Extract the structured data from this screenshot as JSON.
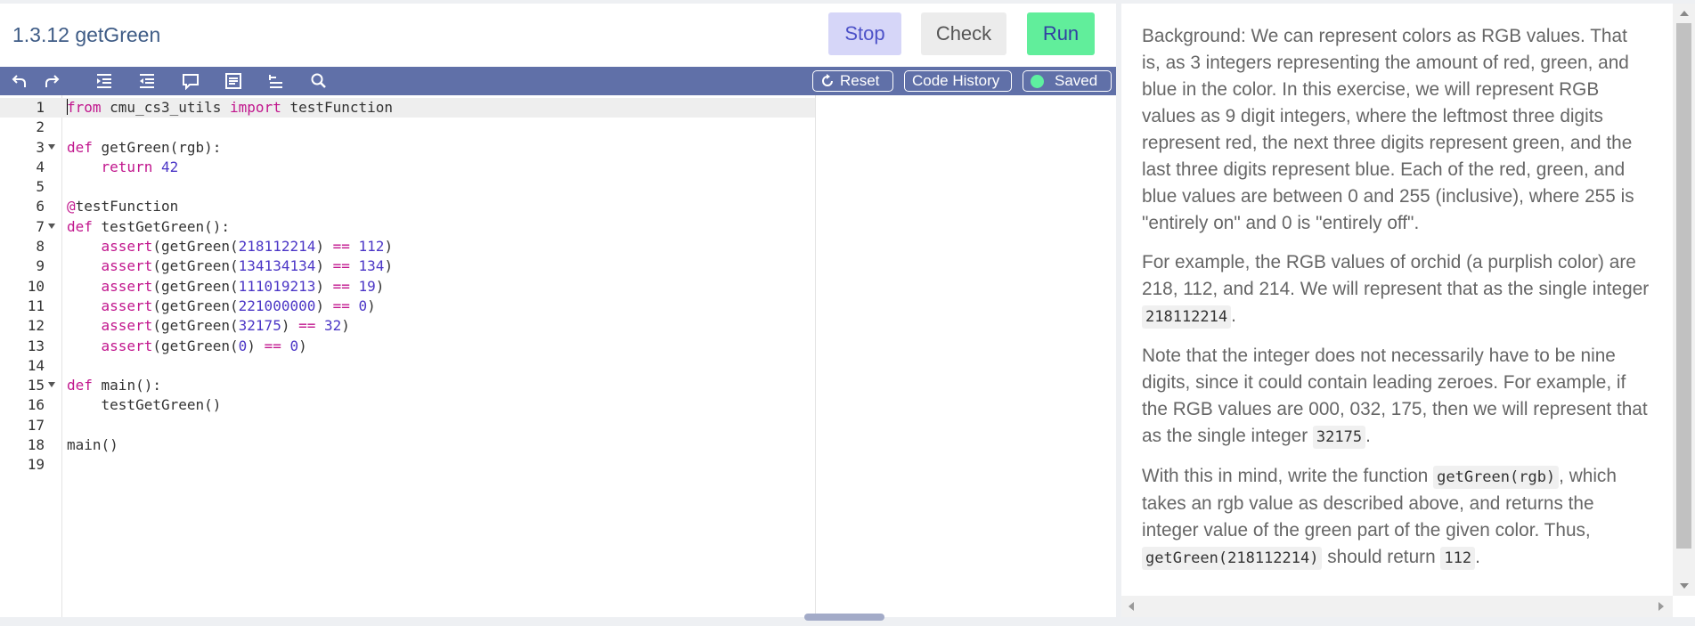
{
  "header": {
    "title": "1.3.12 getGreen",
    "stop_label": "Stop",
    "check_label": "Check",
    "run_label": "Run"
  },
  "toolbar": {
    "icons": [
      "undo-icon",
      "redo-icon",
      "indent-icon",
      "outdent-icon",
      "comment-icon",
      "format-icon",
      "split-icon",
      "search-icon"
    ],
    "reset_label": "Reset",
    "history_label": "Code History",
    "saved_label": "Saved",
    "saved_color": "#5ef0a0"
  },
  "editor": {
    "lines": [
      {
        "n": "1",
        "fold": false,
        "tokens": [
          [
            "kw",
            "from"
          ],
          [
            "t",
            " cmu_cs3_utils "
          ],
          [
            "kw",
            "import"
          ],
          [
            "t",
            " testFunction"
          ]
        ]
      },
      {
        "n": "2",
        "fold": false,
        "tokens": []
      },
      {
        "n": "3",
        "fold": true,
        "tokens": [
          [
            "kw",
            "def"
          ],
          [
            "t",
            " getGreen(rgb):"
          ]
        ]
      },
      {
        "n": "4",
        "fold": false,
        "tokens": [
          [
            "t",
            "    "
          ],
          [
            "kw",
            "return"
          ],
          [
            "t",
            " "
          ],
          [
            "num",
            "42"
          ]
        ]
      },
      {
        "n": "5",
        "fold": false,
        "tokens": []
      },
      {
        "n": "6",
        "fold": false,
        "tokens": [
          [
            "kw",
            "@"
          ],
          [
            "t",
            "testFunction"
          ]
        ]
      },
      {
        "n": "7",
        "fold": true,
        "tokens": [
          [
            "kw",
            "def"
          ],
          [
            "t",
            " testGetGreen():"
          ]
        ]
      },
      {
        "n": "8",
        "fold": false,
        "tokens": [
          [
            "t",
            "    "
          ],
          [
            "kw",
            "assert"
          ],
          [
            "t",
            "(getGreen("
          ],
          [
            "num",
            "218112214"
          ],
          [
            "t",
            ") "
          ],
          [
            "kw",
            "=="
          ],
          [
            "t",
            " "
          ],
          [
            "num",
            "112"
          ],
          [
            "t",
            ")"
          ]
        ]
      },
      {
        "n": "9",
        "fold": false,
        "tokens": [
          [
            "t",
            "    "
          ],
          [
            "kw",
            "assert"
          ],
          [
            "t",
            "(getGreen("
          ],
          [
            "num",
            "134134134"
          ],
          [
            "t",
            ") "
          ],
          [
            "kw",
            "=="
          ],
          [
            "t",
            " "
          ],
          [
            "num",
            "134"
          ],
          [
            "t",
            ")"
          ]
        ]
      },
      {
        "n": "10",
        "fold": false,
        "tokens": [
          [
            "t",
            "    "
          ],
          [
            "kw",
            "assert"
          ],
          [
            "t",
            "(getGreen("
          ],
          [
            "num",
            "111019213"
          ],
          [
            "t",
            ") "
          ],
          [
            "kw",
            "=="
          ],
          [
            "t",
            " "
          ],
          [
            "num",
            "19"
          ],
          [
            "t",
            ")"
          ]
        ]
      },
      {
        "n": "11",
        "fold": false,
        "tokens": [
          [
            "t",
            "    "
          ],
          [
            "kw",
            "assert"
          ],
          [
            "t",
            "(getGreen("
          ],
          [
            "num",
            "221000000"
          ],
          [
            "t",
            ") "
          ],
          [
            "kw",
            "=="
          ],
          [
            "t",
            " "
          ],
          [
            "num",
            "0"
          ],
          [
            "t",
            ")"
          ]
        ]
      },
      {
        "n": "12",
        "fold": false,
        "tokens": [
          [
            "t",
            "    "
          ],
          [
            "kw",
            "assert"
          ],
          [
            "t",
            "(getGreen("
          ],
          [
            "num",
            "32175"
          ],
          [
            "t",
            ") "
          ],
          [
            "kw",
            "=="
          ],
          [
            "t",
            " "
          ],
          [
            "num",
            "32"
          ],
          [
            "t",
            ")"
          ]
        ]
      },
      {
        "n": "13",
        "fold": false,
        "tokens": [
          [
            "t",
            "    "
          ],
          [
            "kw",
            "assert"
          ],
          [
            "t",
            "(getGreen("
          ],
          [
            "num",
            "0"
          ],
          [
            "t",
            ") "
          ],
          [
            "kw",
            "=="
          ],
          [
            "t",
            " "
          ],
          [
            "num",
            "0"
          ],
          [
            "t",
            ")"
          ]
        ]
      },
      {
        "n": "14",
        "fold": false,
        "tokens": []
      },
      {
        "n": "15",
        "fold": true,
        "tokens": [
          [
            "kw",
            "def"
          ],
          [
            "t",
            " main():"
          ]
        ]
      },
      {
        "n": "16",
        "fold": false,
        "tokens": [
          [
            "t",
            "    testGetGreen()"
          ]
        ]
      },
      {
        "n": "17",
        "fold": false,
        "tokens": []
      },
      {
        "n": "18",
        "fold": false,
        "tokens": [
          [
            "t",
            "main()"
          ]
        ]
      },
      {
        "n": "19",
        "fold": false,
        "tokens": []
      }
    ]
  },
  "instructions": {
    "paragraphs": [
      [
        [
          "t",
          "Background: We can represent colors as RGB values. That is, as 3 integers representing the amount of red, green, and blue in the color. In this exercise, we will represent RGB values as 9 digit integers, where the leftmost three digits represent red, the next three digits represent green, and the last three digits represent blue. Each of the red, green, and blue values are between 0 and 255 (inclusive), where 255 is \"entirely on\" and 0 is \"entirely off\"."
        ]
      ],
      [
        [
          "t",
          "For example, the RGB values of orchid (a purplish color) are 218, 112, and 214. We will represent that as the single integer "
        ],
        [
          "c",
          "218112214"
        ],
        [
          "t",
          "."
        ]
      ],
      [
        [
          "t",
          "Note that the integer does not necessarily have to be nine digits, since it could contain leading zeroes. For example, if the RGB values are 000, 032, 175, then we will represent that as the single integer "
        ],
        [
          "c",
          "32175"
        ],
        [
          "t",
          "."
        ]
      ],
      [
        [
          "t",
          "With this in mind, write the function "
        ],
        [
          "c",
          "getGreen(rgb)"
        ],
        [
          "t",
          ", which takes an rgb value as described above, and returns the integer value of the green part of the given color. Thus, "
        ],
        [
          "c",
          "getGreen(218112214)"
        ],
        [
          "t",
          " should return "
        ],
        [
          "c",
          "112"
        ],
        [
          "t",
          "."
        ]
      ]
    ]
  },
  "colors": {
    "toolbar_bg": "#6070a8",
    "keyword": "#c1168d",
    "number": "#4b36c6",
    "stop_bg": "#d6d6f8",
    "run_bg": "#61ee9b"
  }
}
